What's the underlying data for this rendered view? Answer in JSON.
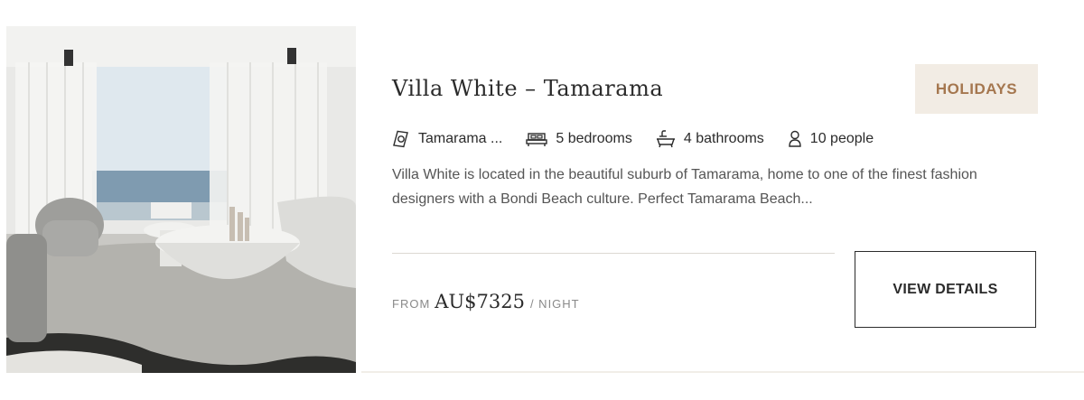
{
  "listing": {
    "title": "Villa White – Tamarama",
    "badge": "HOLIDAYS",
    "amenities": {
      "location": "Tamarama ...",
      "bedrooms": "5 bedrooms",
      "bathrooms": "4 bathrooms",
      "guests": "10 people"
    },
    "description": "Villa White is located in the beautiful suburb of Tamarama, home to one of the finest fashion designers with a Bondi Beach culture. Perfect Tamarama Beach...",
    "price": {
      "prefix": "FROM",
      "amount": "AU$7325",
      "suffix": "/ NIGHT"
    },
    "cta_label": "VIEW DETAILS"
  },
  "icons": {
    "location": "location-pin-icon",
    "bedrooms": "bed-icon",
    "bathrooms": "bathtub-icon",
    "guests": "person-icon"
  },
  "colors": {
    "badge_bg": "#f2ece4",
    "badge_text": "#a5774f",
    "text": "#2b2b2b",
    "muted": "#8a8a8a"
  }
}
